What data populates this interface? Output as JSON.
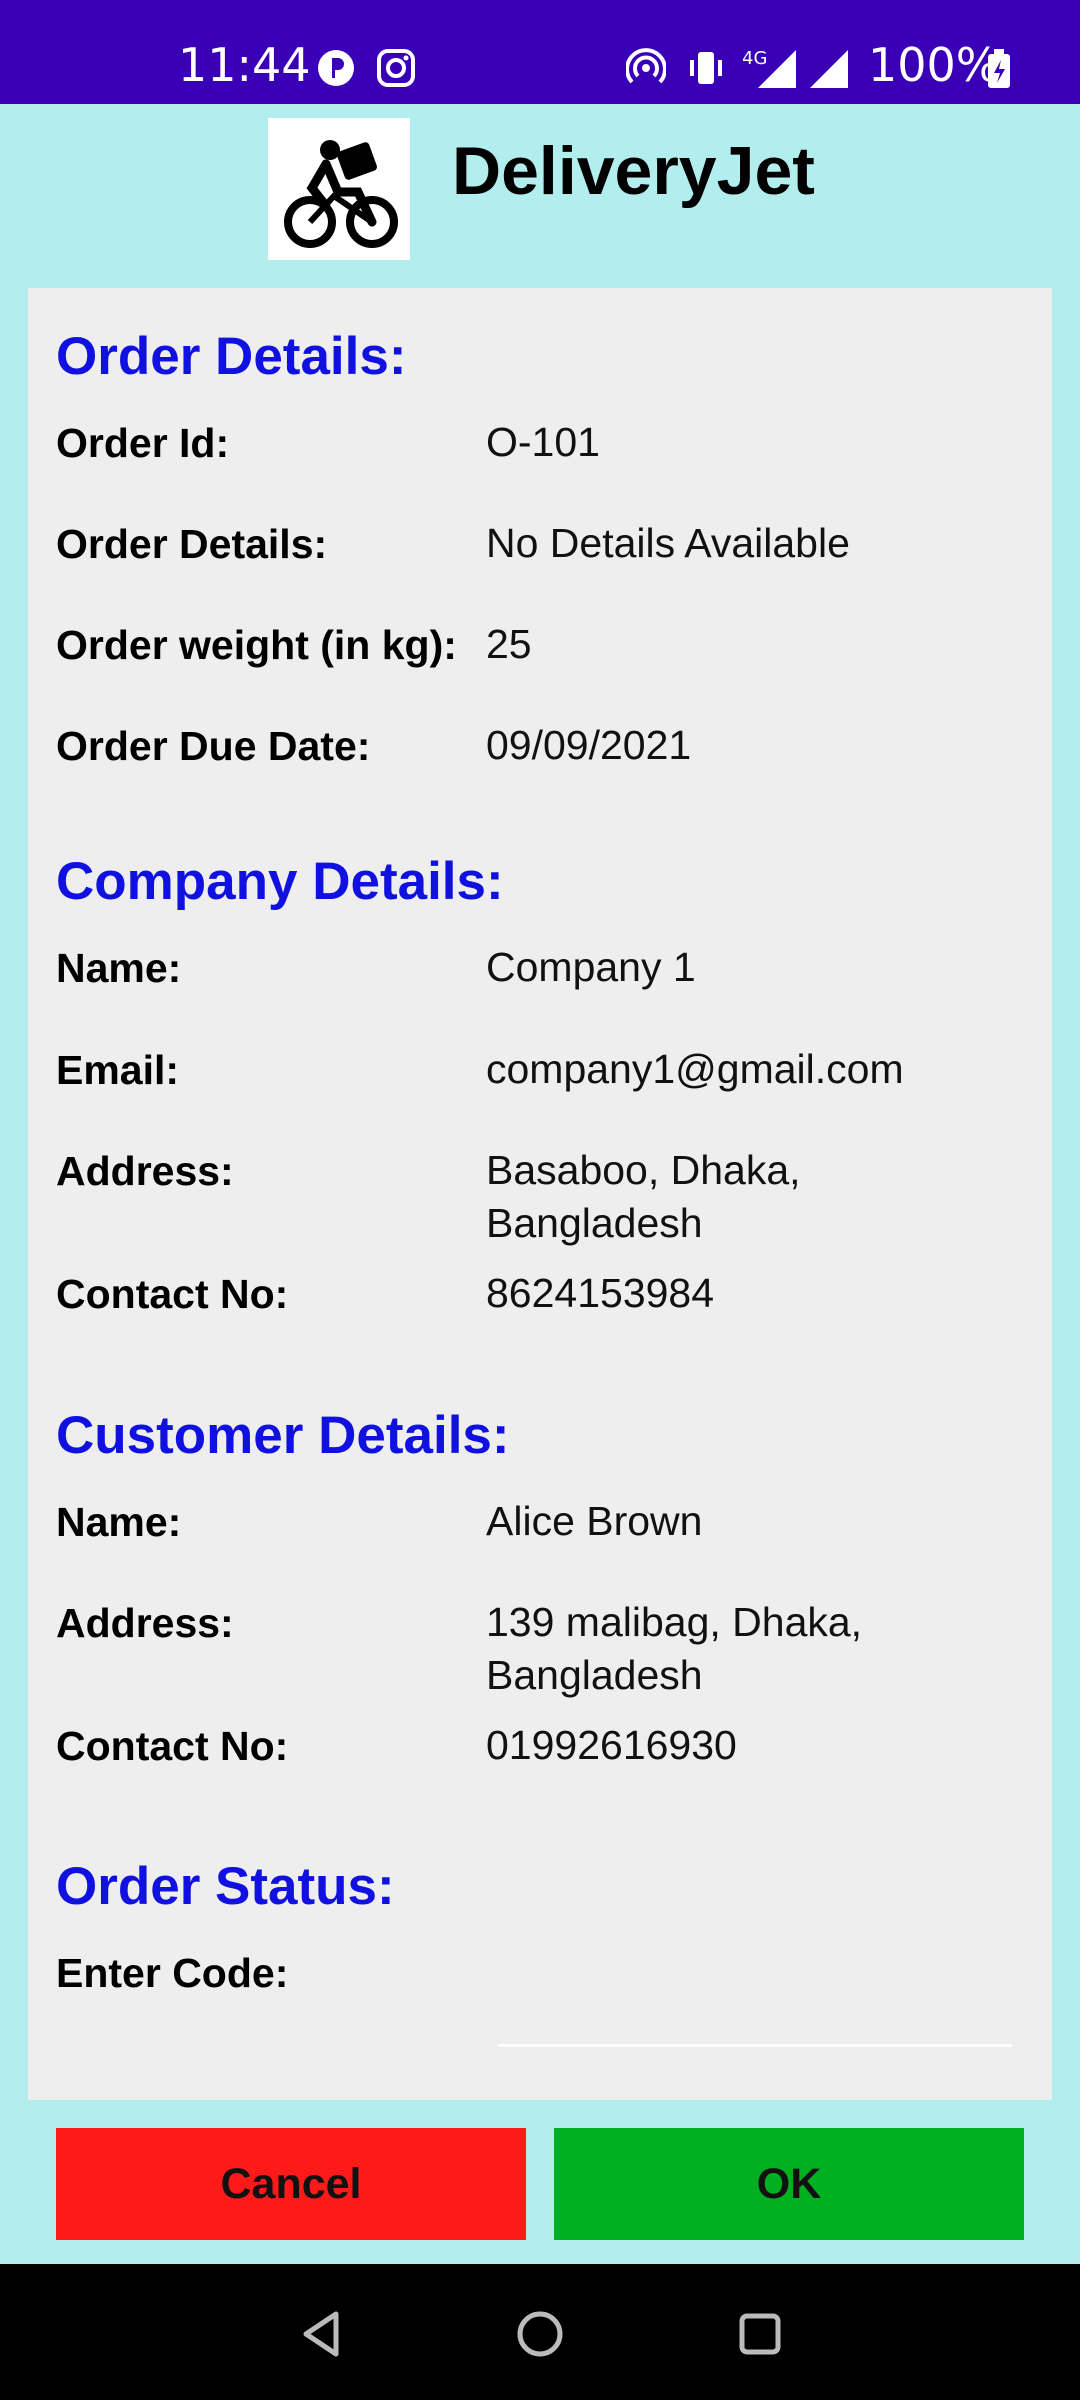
{
  "status_bar": {
    "time": "11:44",
    "battery": "100%",
    "network": "4G",
    "icons": [
      "whatsapp-icon",
      "instagram-icon",
      "hotspot-icon",
      "vibrate-icon",
      "signal-icon",
      "battery-charging-icon"
    ]
  },
  "header": {
    "title": "DeliveryJet",
    "logo_icon": "bicycle-delivery-icon"
  },
  "order": {
    "heading": "Order Details:",
    "id_label": "Order Id:",
    "id_value": "O-101",
    "details_label": "Order Details:",
    "details_value": "No Details Available",
    "weight_label": "Order weight (in kg):",
    "weight_value": "25",
    "due_label": "Order Due Date:",
    "due_value": "09/09/2021"
  },
  "company": {
    "heading": "Company Details:",
    "name_label": "Name:",
    "name_value": "Company 1",
    "email_label": "Email:",
    "email_value": "company1@gmail.com",
    "address_label": "Address:",
    "address_value": "Basaboo, Dhaka, Bangladesh",
    "contact_label": "Contact No:",
    "contact_value": "8624153984"
  },
  "customer": {
    "heading": "Customer Details:",
    "name_label": "Name:",
    "name_value": "Alice Brown",
    "address_label": "Address:",
    "address_value": "139 malibag, Dhaka, Bangladesh",
    "contact_label": "Contact No:",
    "contact_value": "01992616930"
  },
  "status": {
    "heading": "Order Status:",
    "code_label": "Enter Code:",
    "code_value": ""
  },
  "actions": {
    "cancel_label": "Cancel",
    "ok_label": "OK"
  },
  "colors": {
    "background": "#b2eeee",
    "status_bar": "#3a00b8",
    "heading": "#1010e0",
    "cancel": "#ff1a1a",
    "ok": "#00b020"
  },
  "nav": {
    "icons": [
      "back-icon",
      "home-icon",
      "recents-icon"
    ]
  }
}
